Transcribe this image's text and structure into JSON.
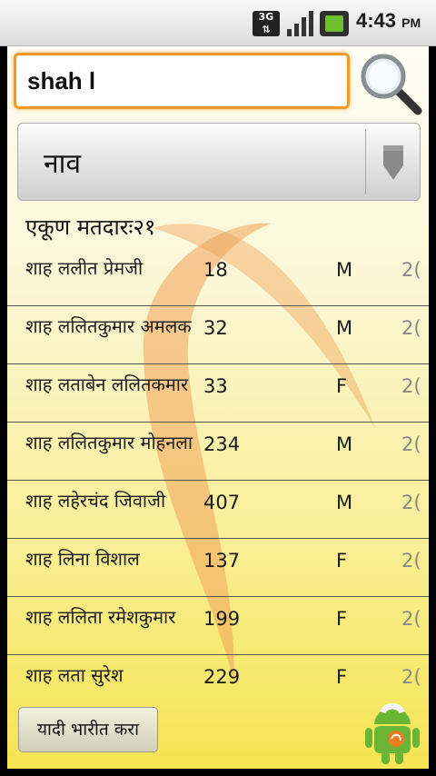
{
  "status_bar": {
    "network_type": "3G",
    "time": "4:43",
    "ampm": "PM",
    "icons": [
      "network-3g-icon",
      "signal-icon",
      "battery-charging-icon"
    ]
  },
  "search": {
    "value": "shah l",
    "icon": "search-icon"
  },
  "filter": {
    "selected": "नाव",
    "icon": "chevron-down-icon"
  },
  "total_label": "एकूण मतदारः२१",
  "voters": [
    {
      "name": "शाह ललीत प्रेमजी",
      "number": "18",
      "gender": "M",
      "extra": "2("
    },
    {
      "name": "शाह ललितकुमार अमलक",
      "number": "32",
      "gender": "M",
      "extra": "2("
    },
    {
      "name": "शाह लताबेन ललितकमार",
      "number": "33",
      "gender": "F",
      "extra": "2("
    },
    {
      "name": "शाह ललितकुमार मोहनला",
      "number": "234",
      "gender": "M",
      "extra": "2("
    },
    {
      "name": "शाह लहेरचंद जिवाजी",
      "number": "407",
      "gender": "M",
      "extra": "2("
    },
    {
      "name": "शाह लिना विशाल",
      "number": "137",
      "gender": "F",
      "extra": "2("
    },
    {
      "name": "शाह ललिता रमेशकुमार",
      "number": "199",
      "gender": "F",
      "extra": "2("
    },
    {
      "name": "शाह लता सुरेश",
      "number": "229",
      "gender": "F",
      "extra": "2("
    }
  ],
  "export_button": "यादी भारीत करा",
  "colors": {
    "accent": "#f29a24",
    "background_top": "#fdfdf5",
    "background_bottom": "#f5e452"
  }
}
